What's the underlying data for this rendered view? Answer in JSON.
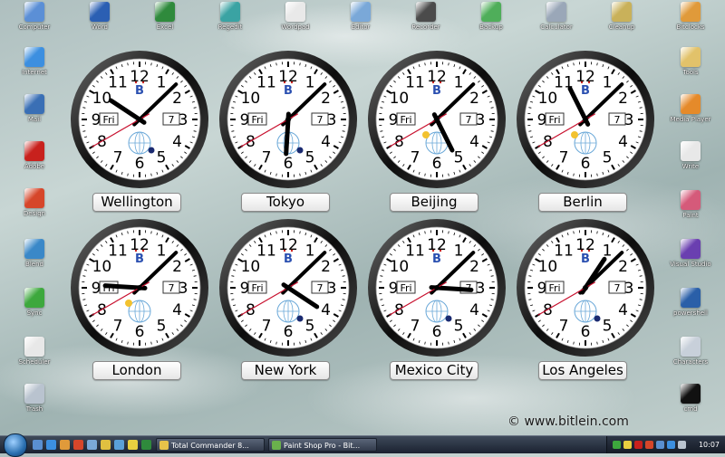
{
  "desktop_icons": [
    {
      "label": "Computer",
      "color": "#5b8fd6"
    },
    {
      "label": "Word",
      "color": "#2b5fb3"
    },
    {
      "label": "Excel",
      "color": "#2f8a3c"
    },
    {
      "label": "Regedit",
      "color": "#3aa3a3"
    },
    {
      "label": "Wordpad",
      "color": "#e9e9e9"
    },
    {
      "label": "Editor",
      "color": "#7aa8d8"
    },
    {
      "label": "Recorder",
      "color": "#4b4b4b"
    },
    {
      "label": "Backup",
      "color": "#4fae5a"
    },
    {
      "label": "Calculator",
      "color": "#9aa7b8"
    },
    {
      "label": "Cleanup",
      "color": "#c9b15a"
    },
    {
      "label": "Bitclocks",
      "color": "#e09a3a"
    },
    {
      "label": "Internet",
      "color": "#3c8fe0"
    },
    {
      "label": "Mail",
      "color": "#3a6fb5"
    },
    {
      "label": "Adobe",
      "color": "#c8211d"
    },
    {
      "label": "Design",
      "color": "#d6462a"
    },
    {
      "label": "Blend",
      "color": "#3a88c8"
    },
    {
      "label": "Sync",
      "color": "#3da83d"
    },
    {
      "label": "Scheduler",
      "color": "#e8e8e8"
    },
    {
      "label": "Trash",
      "color": "#b9c3cf"
    },
    {
      "label": "Tools",
      "color": "#e2c26a"
    },
    {
      "label": "Media Player",
      "color": "#e58a2a"
    },
    {
      "label": "Write",
      "color": "#e8e8e8"
    },
    {
      "label": "Paint",
      "color": "#d55a7a"
    },
    {
      "label": "Visual Studio",
      "color": "#6a3fb0"
    },
    {
      "label": "powershell",
      "color": "#2a5fa8"
    },
    {
      "label": "Characters",
      "color": "#c8d0da"
    },
    {
      "label": "cmd",
      "color": "#111111"
    }
  ],
  "clocks": [
    {
      "city": "Wellington",
      "day": "Fri",
      "date": "7",
      "hour": 10,
      "minute": 7,
      "second": 40,
      "marker": "moon"
    },
    {
      "city": "Tokyo",
      "day": "Fri",
      "date": "7",
      "hour": 6,
      "minute": 7,
      "second": 40,
      "marker": "moon"
    },
    {
      "city": "Beijing",
      "day": "Fri",
      "date": "7",
      "hour": 5,
      "minute": 7,
      "second": 40,
      "marker": "sun"
    },
    {
      "city": "Berlin",
      "day": "Fri",
      "date": "7",
      "hour": 23,
      "minute": 7,
      "second": 40,
      "marker": "sun"
    },
    {
      "city": "London",
      "day": "Fri",
      "date": "7",
      "hour": 21,
      "minute": 7,
      "second": 40,
      "marker": "sun"
    },
    {
      "city": "New York",
      "day": "Fri",
      "date": "7",
      "hour": 4,
      "minute": 7,
      "second": 40,
      "marker": "moon"
    },
    {
      "city": "Mexico City",
      "day": "Fri",
      "date": "7",
      "hour": 3,
      "minute": 7,
      "second": 40,
      "marker": "moon"
    },
    {
      "city": "Los Angeles",
      "day": "Fri",
      "date": "7",
      "hour": 1,
      "minute": 7,
      "second": 40,
      "marker": "moon"
    }
  ],
  "clock_numerals": [
    "12",
    "1",
    "2",
    "3",
    "4",
    "5",
    "6",
    "7",
    "8",
    "9",
    "10",
    "11"
  ],
  "clock_brand": "B",
  "watermark": "© www.bitlein.com",
  "taskbar": {
    "tasks": [
      {
        "label": "Total Commander 8...",
        "color": "#e7c24a"
      },
      {
        "label": "Paint Shop Pro - Bit...",
        "color": "#6ab04c"
      }
    ],
    "time": "10:07"
  },
  "colors": {
    "second_hand": "#c8102e",
    "brand": "#2a4fb0",
    "moon": "#1a2a70",
    "sun": "#f2c230",
    "globe": "#6aa8d8"
  }
}
